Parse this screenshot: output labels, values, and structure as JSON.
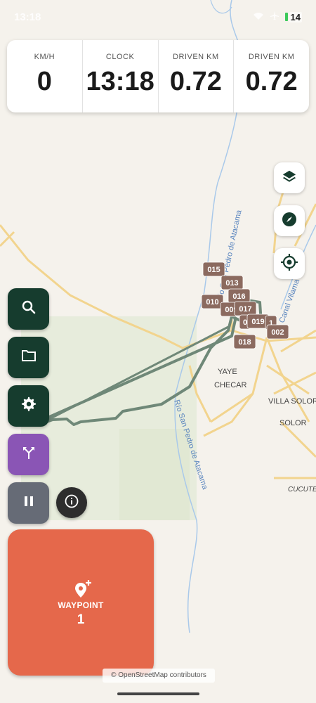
{
  "status_bar": {
    "time": "13:18",
    "battery": "14"
  },
  "dashboard": [
    {
      "label": "KM/H",
      "value": "0"
    },
    {
      "label": "CLOCK",
      "value": "13:18"
    },
    {
      "label": "DRIVEN KM",
      "value": "0.72"
    },
    {
      "label": "DRIVEN KM",
      "value": "0.72"
    }
  ],
  "map": {
    "place_labels": [
      "YAYE",
      "CHECAR",
      "VILLA SOLOR",
      "SOLOR",
      "CUCUTE"
    ],
    "river_labels": [
      "Río San Pedro de Atacama",
      "Río San Pedro de Atacama",
      "Canal Vilama"
    ],
    "waypoint_markers": [
      "015",
      "013",
      "016",
      "010",
      "009",
      "017",
      "0",
      "019",
      "1",
      "002",
      "018"
    ],
    "attribution": "© OpenStreetMap contributors"
  },
  "map_buttons": [
    {
      "name": "layers-button",
      "icon": "layers-icon"
    },
    {
      "name": "compass-button",
      "icon": "compass-icon"
    },
    {
      "name": "my-location-button",
      "icon": "my-location-icon"
    }
  ],
  "side_buttons": [
    {
      "name": "search-button",
      "icon": "search-icon",
      "color": "#163c2e"
    },
    {
      "name": "folder-button",
      "icon": "folder-icon",
      "color": "#163c2e"
    },
    {
      "name": "settings-button",
      "icon": "gear-icon",
      "color": "#163c2e"
    },
    {
      "name": "route-button",
      "icon": "fork-icon",
      "color": "#8a55b5"
    },
    {
      "name": "pause-button",
      "icon": "pause-icon",
      "color": "#666b76"
    }
  ],
  "waypoint_button": {
    "label": "WAYPOINT",
    "count": "1",
    "color": "#e5684b"
  },
  "colors": {
    "track": "#6b8577",
    "marker": "#8b6a5f",
    "road": "#f6d58a",
    "river": "#9cc1e6",
    "park": "#e5ead9"
  }
}
